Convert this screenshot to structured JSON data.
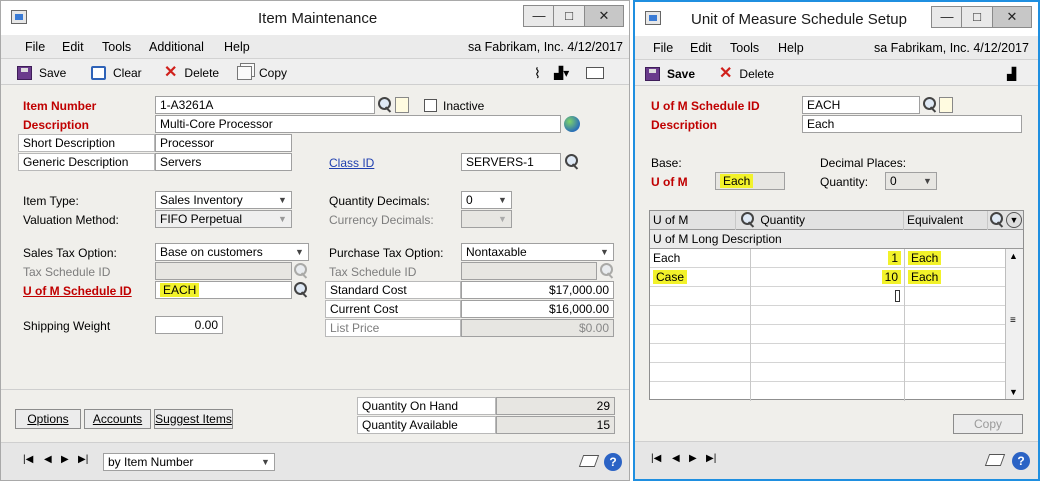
{
  "item": {
    "title": "Item Maintenance",
    "menu": [
      "File",
      "Edit",
      "Tools",
      "Additional",
      "Help"
    ],
    "user_info": "sa  Fabrikam, Inc.  4/12/2017",
    "toolbar": {
      "save": "Save",
      "clear": "Clear",
      "delete": "Delete",
      "copy": "Copy"
    },
    "labels": {
      "item_number": "Item Number",
      "inactive": "Inactive",
      "description": "Description",
      "short_description": "Short Description",
      "generic_description": "Generic Description",
      "class_id": "Class ID",
      "item_type": "Item Type:",
      "valuation_method": "Valuation Method:",
      "quantity_decimals": "Quantity Decimals:",
      "currency_decimals": "Currency Decimals:",
      "sales_tax_option": "Sales Tax Option:",
      "purchase_tax_option": "Purchase Tax Option:",
      "tax_schedule_id": "Tax Schedule ID",
      "uofm_schedule_id": "U of M Schedule ID",
      "standard_cost": "Standard Cost",
      "current_cost": "Current Cost",
      "list_price": "List Price",
      "shipping_weight": "Shipping Weight",
      "quantity_on_hand": "Quantity On Hand",
      "quantity_available": "Quantity Available"
    },
    "values": {
      "item_number": "1-A3261A",
      "description": "Multi-Core Processor",
      "short_description": "Processor",
      "generic_description": "Servers",
      "class_id": "SERVERS-1",
      "item_type": "Sales Inventory",
      "valuation_method": "FIFO Perpetual",
      "quantity_decimals": "0",
      "sales_tax_option": "Base on customers",
      "purchase_tax_option": "Nontaxable",
      "uofm_schedule_id": "EACH",
      "standard_cost": "$17,000.00",
      "current_cost": "$16,000.00",
      "list_price": "$0.00",
      "shipping_weight": "0.00",
      "quantity_on_hand": "29",
      "quantity_available": "15"
    },
    "buttons": {
      "options": "Options",
      "accounts": "Accounts",
      "suggest_items": "Suggest Items"
    },
    "sort_by": "by Item Number"
  },
  "uom": {
    "title": "Unit of Measure Schedule Setup",
    "menu": [
      "File",
      "Edit",
      "Tools",
      "Help"
    ],
    "user_info": "sa  Fabrikam, Inc.  4/12/2017",
    "toolbar": {
      "save": "Save",
      "delete": "Delete"
    },
    "labels": {
      "schedule_id": "U of M Schedule ID",
      "description": "Description",
      "base": "Base:",
      "uofm": "U of M",
      "decimal_places": "Decimal Places:",
      "quantity": "Quantity:"
    },
    "values": {
      "schedule_id": "EACH",
      "description": "Each",
      "base_uofm": "Each",
      "quantity_decimals": "0"
    },
    "grid": {
      "col_uofm": "U of M",
      "col_quantity": "Quantity",
      "col_equivalent": "Equivalent",
      "sub_header": "U of M Long Description",
      "rows": [
        {
          "uofm": "Each",
          "quantity": "1",
          "equivalent": "Each"
        },
        {
          "uofm": "Case",
          "quantity": "10",
          "equivalent": "Each"
        }
      ]
    },
    "copy_button": "Copy"
  }
}
